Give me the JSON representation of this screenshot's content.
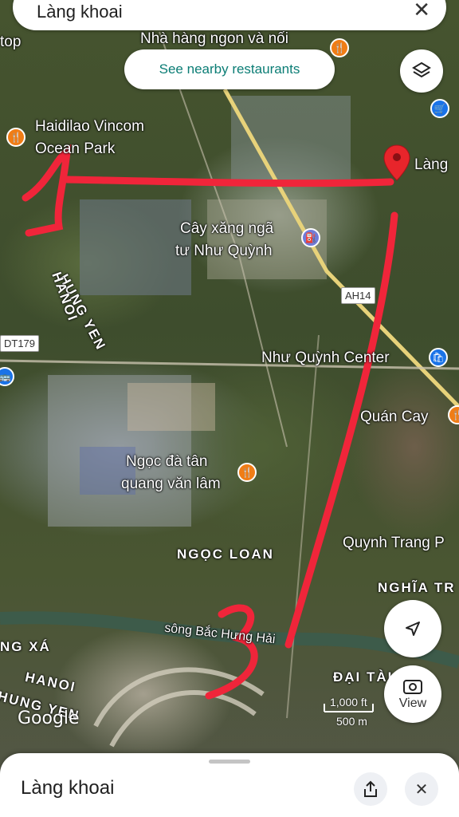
{
  "search": {
    "query": "Làng khoai",
    "close_icon": "close-icon"
  },
  "chip": {
    "label": "See nearby restaurants"
  },
  "labels": {
    "top_left": "top",
    "restaurant_top": "Nhà hàng ngon và nối",
    "haidilao_1": "Haidilao Vincom",
    "haidilao_2": "Ocean Park",
    "lang_pin": "Làng",
    "cay_xang_1": "Cây xăng ngã",
    "cay_xang_2": "tư Như Quỳnh",
    "hung_yen": "HUNG YEN",
    "hanoi": "HANOI",
    "ah14": "AH14",
    "dt179": "DT179",
    "nhu_quynh_center": "Như Quỳnh Center",
    "quan_cay": "Quán Cay",
    "ngoc_da_1": "Ngọc đà tân",
    "ngoc_da_2": "quang văn lâm",
    "ngoc_loan": "NGỌC LOAN",
    "quynh_trang": "Quynh Trang P",
    "nghia_tr": "NGHĨA TR",
    "song_bac": "sông Bắc Hưng Hải",
    "ng_xa": "NG XÁ",
    "hanoi_2": "HANOI",
    "hung_yen_2": "HUNG YEN",
    "dai_tai": "ĐẠI TÀI"
  },
  "scale": {
    "ft": "1,000 ft",
    "m": "500 m"
  },
  "buttons": {
    "view_label": "View"
  },
  "google": "Google",
  "sheet": {
    "title": "Làng khoai"
  },
  "colors": {
    "teal": "#0b7d75",
    "marker": "#e8252b",
    "annotation": "#f0253a"
  }
}
